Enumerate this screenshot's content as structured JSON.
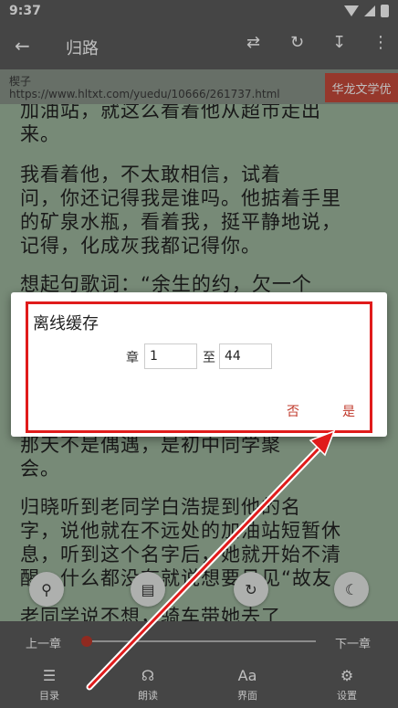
{
  "status": {
    "time": "9:37"
  },
  "toolbar": {
    "title": "归路"
  },
  "source": {
    "author": "楔子",
    "url": "https://www.hltxt.com/yuedu/10666/261737.html",
    "badge": "华龙文学优"
  },
  "reader": {
    "lines": [
      "加油站，就这么看着他从超市走出",
      "来。",
      "    我看着他，不太敢相信，试着",
      "问，你还记得我是谁吗。他掂着手里",
      "的矿泉水瓶，看着我，挺平静地说，",
      "记得，化成灰我都记得你。",
      "    想起句歌词：“余生的约，欠一个",
      "那天不是偶遇，是初中同学聚",
      "会。",
      "    归晓听到老同学白浩提到他的名",
      "字，说他就在不远处的加油站短暂休",
      "息，听到这个名字后，她就开始不清",
      "醒，什么都没有就说想要见见“故友",
      "    老同学说不想，骑车带她去了"
    ]
  },
  "chapter_bar": {
    "prev": "上一章",
    "next": "下一章",
    "progress": 0.0
  },
  "bottom_nav": {
    "catalog": "目录",
    "read_aloud": "朗读",
    "interface": "界面",
    "settings": "设置"
  },
  "dialog": {
    "title": "离线缓存",
    "from_label": "章",
    "from_value": "1",
    "to_label": "至",
    "to_value": "44",
    "no_label": "否",
    "yes_label": "是"
  },
  "colors": {
    "accent": "#c0392b",
    "annotation": "#e01b1b",
    "bar": "#5c5c5c",
    "page": "#9fb89f"
  }
}
